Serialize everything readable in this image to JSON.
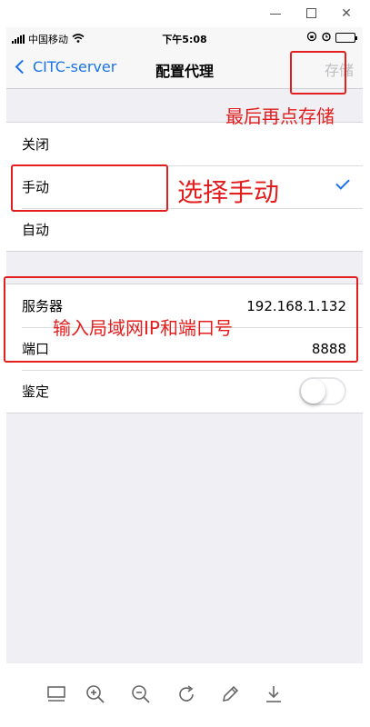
{
  "status": {
    "carrier": "中国移动",
    "time": "下午5:08"
  },
  "nav": {
    "back_label": "CITC-server",
    "title": "配置代理",
    "save_label": "存储"
  },
  "proxy_modes": [
    {
      "label": "关闭",
      "selected": false
    },
    {
      "label": "手动",
      "selected": true
    },
    {
      "label": "自动",
      "selected": false
    }
  ],
  "server": {
    "label": "服务器",
    "value": "192.168.1.132"
  },
  "port": {
    "label": "端口",
    "value": "8888"
  },
  "auth": {
    "label": "鉴定",
    "enabled": false
  },
  "annotations": {
    "save": "最后再点存储",
    "manual": "选择手动",
    "ip_port": "输入局域网IP和端口号"
  },
  "colors": {
    "accent": "#1a73e8",
    "annotation": "#e21e1e",
    "background": "#efeff4"
  },
  "toolbar_icons": [
    "fit-screen-icon",
    "zoom-in-icon",
    "zoom-out-icon",
    "rotate-icon",
    "edit-icon",
    "download-icon"
  ]
}
